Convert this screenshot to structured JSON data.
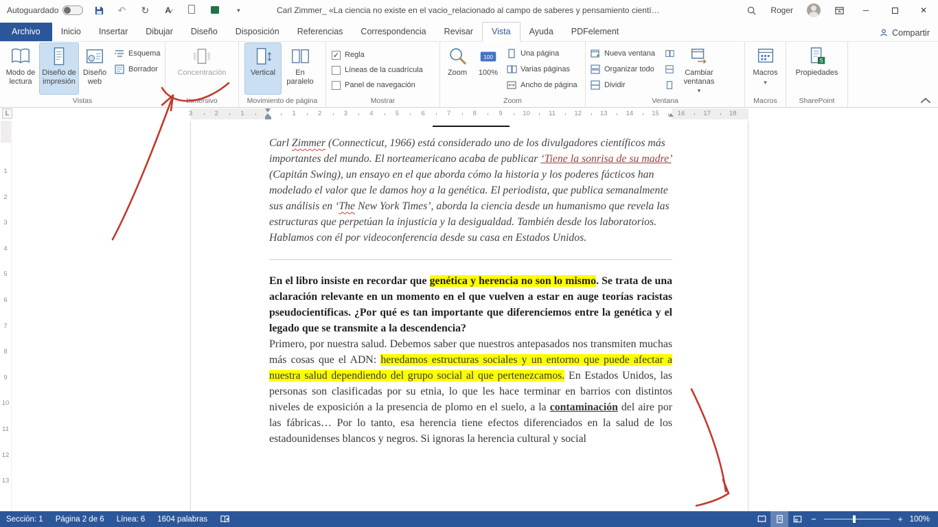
{
  "titlebar": {
    "autosave_label": "Autoguardado",
    "title": "Carl Zimmer_ «La ciencia no existe en el vacio_relacionado al campo de saberes y pensamiento científico.docx  -  W...",
    "user": "Roger"
  },
  "tabs": {
    "items": [
      "Archivo",
      "Inicio",
      "Insertar",
      "Dibujar",
      "Diseño",
      "Disposición",
      "Referencias",
      "Correspondencia",
      "Revisar",
      "Vista",
      "Ayuda",
      "PDFelement"
    ],
    "share_label": "Compartir"
  },
  "ribbon": {
    "vistas": {
      "label": "Vistas",
      "modo": "Modo de lectura",
      "impresion": "Diseño de impresión",
      "web": "Diseño web",
      "esquema": "Esquema",
      "borrador": "Borrador"
    },
    "inmersivo": {
      "label": "Inmersivo",
      "concentracion": "Concentración"
    },
    "movimiento": {
      "label": "Movimiento de página",
      "vertical": "Vertical",
      "paralelo": "En paralelo"
    },
    "mostrar": {
      "label": "Mostrar",
      "items": [
        {
          "label": "Regla",
          "mark": "✓"
        },
        {
          "label": "Líneas de la cuadrícula",
          "mark": ""
        },
        {
          "label": "Panel de navegación",
          "mark": ""
        }
      ]
    },
    "zoom": {
      "label": "Zoom",
      "zoom": "Zoom",
      "cien": "100%",
      "una": "Una página",
      "varias": "Varias páginas",
      "ancho": "Ancho de página"
    },
    "ventana": {
      "label": "Ventana",
      "nueva": "Nueva ventana",
      "organizar": "Organizar todo",
      "dividir": "Dividir",
      "cambiar": "Cambiar ventanas"
    },
    "macros": {
      "label": "Macros",
      "button": "Macros"
    },
    "sharepoint": {
      "label": "SharePoint",
      "propiedades": "Propiedades"
    }
  },
  "ruler": {
    "left_numbers": [
      "3",
      "2",
      "1"
    ],
    "numbers": [
      "1",
      "2",
      "3",
      "4",
      "5",
      "6",
      "7",
      "8",
      "9",
      "10",
      "11",
      "12",
      "13",
      "14",
      "15",
      "16",
      "17",
      "18"
    ],
    "v_numbers": [
      "1",
      "2",
      "3",
      "4",
      "5",
      "6",
      "7",
      "8",
      "9",
      "10",
      "11",
      "12",
      "13"
    ]
  },
  "document": {
    "paragraphs": [
      {
        "class": "intro",
        "runs": [
          {
            "t": "Carl ",
            "i": 1
          },
          {
            "t": "Zimmer",
            "i": 1,
            "wavy": 1
          },
          {
            "t": " (Connecticut, 1966) está considerado uno de los divulgadores científicos más importantes del mundo. El norteamericano acaba de publicar ",
            "i": 1
          },
          {
            "t": "‘Tiene la sonrisa de su madre’",
            "i": 1,
            "link": 1
          },
          {
            "t": " (Capitán Swing), un ensayo en el que aborda cómo la historia y los poderes fácticos han modelado el valor que le damos hoy a la genética. El periodista, que publica semanalmente sus análisis en ‘",
            "i": 1
          },
          {
            "t": "The",
            "i": 1,
            "wavy": 1
          },
          {
            "t": " New York Times’, aborda la ciencia desde un humanismo que revela las estructuras que perpetúan la injusticia y la desigualdad. También desde los laboratorios. Hablamos con él por videoconferencia desde su casa en Estados Unidos.",
            "i": 1
          }
        ]
      },
      {
        "hr": true
      },
      {
        "class": "q",
        "runs": [
          {
            "t": "En el libro insiste en recordar que ",
            "b": 1
          },
          {
            "t": "genética y herencia no son lo mismo",
            "b": 1,
            "hl": 1
          },
          {
            "t": ". Se trata de una aclaración relevante en un momento en el que vuelven a estar en auge teorías racistas pseudocientíficas. ¿Por qué es tan importante que diferenciemos entre la genética y el legado que se transmite a la descendencia?",
            "b": 1
          }
        ]
      },
      {
        "class": "a",
        "runs": [
          {
            "t": "Primero, por nuestra salud. Debemos saber que nuestros antepasados nos transmiten muchas más cosas que el ADN: "
          },
          {
            "t": "heredamos estructuras sociales y un entorno que puede afectar a nuestra salud dependiendo del grupo social al que pertenezcamos.",
            "hl": 1
          },
          {
            "t": " En Estados Unidos, las personas son clasificadas por su etnia, lo que les hace terminar en barrios con distintos niveles de exposición a la presencia de plomo en el suelo, a la "
          },
          {
            "t": "contaminación",
            "b": 1,
            "u": 1
          },
          {
            "t": " del aire por las fábricas… Por lo tanto, esa herencia tiene efectos diferenciados en la salud de los estadounidenses blancos y negros. Si ignoras la herencia cultural y social"
          }
        ]
      }
    ]
  },
  "statusbar": {
    "section": "Sección: 1",
    "page": "Página 2 de 6",
    "line": "Línea: 6",
    "words": "1604 palabras",
    "zoom": "100%"
  },
  "colors": {
    "accent": "#2b579a",
    "highlight": "#ffff00",
    "annotation": "#c13a2d"
  },
  "icons": [
    "floppy-disk",
    "undo-arrow",
    "redo-arrow",
    "letter-a",
    "touch-page",
    "green-table",
    "chevron-down",
    "magnifier",
    "user-avatar",
    "ribbon-options",
    "window-minimize",
    "window-maximize",
    "window-close",
    "share-person",
    "read-mode-book",
    "print-layout-page",
    "web-layout-page",
    "outline-list",
    "draft-page",
    "focus-view",
    "vertical-move",
    "side-by-side-pages",
    "zoom-magnifier",
    "zoom-100-badge",
    "one-page",
    "multiple-pages",
    "page-width",
    "new-window",
    "arrange-all",
    "split-window",
    "switch-windows",
    "sync-scroll",
    "reset-window",
    "macros-window",
    "properties-doc",
    "spell-check-book",
    "zoom-out-minus",
    "zoom-in-plus",
    "collapse-ribbon-chevron",
    "tab-selector"
  ]
}
